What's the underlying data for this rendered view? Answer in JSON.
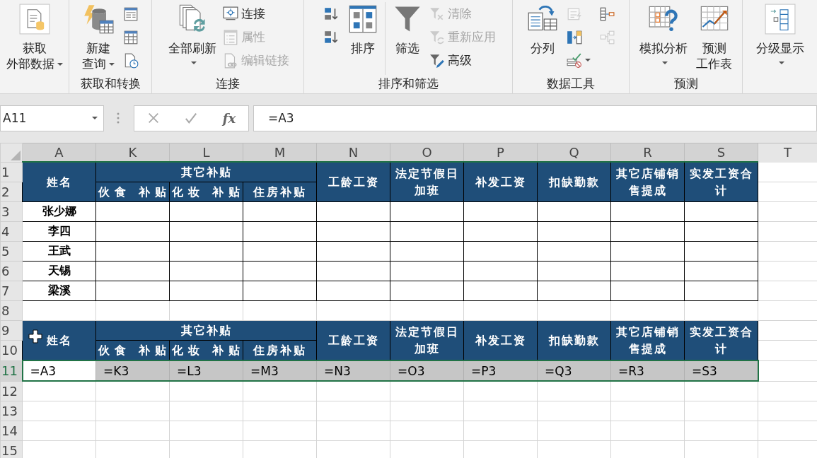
{
  "ribbon": {
    "groups": [
      {
        "columns": [
          [
            {
              "kind": "large",
              "lines": [
                "获取",
                "外部数据"
              ],
              "dropdown": true,
              "disabled": false
            }
          ]
        ]
      },
      {
        "label": "获取和转换",
        "columns": [
          [
            {
              "kind": "large",
              "lines": [
                "新建",
                "查询"
              ],
              "dropdown": true,
              "disabled": false
            }
          ],
          [
            {
              "kind": "icon",
              "disabled": false
            },
            {
              "kind": "icon",
              "disabled": false
            },
            {
              "kind": "icon",
              "disabled": false
            }
          ]
        ]
      },
      {
        "label": "连接",
        "columns": [
          [
            {
              "kind": "large",
              "lines": [
                "全部刷新"
              ],
              "dropdown": true,
              "disabled": false
            }
          ],
          [
            {
              "kind": "small",
              "label": "连接",
              "disabled": false
            },
            {
              "kind": "small",
              "label": "属性",
              "disabled": true
            },
            {
              "kind": "small",
              "label": "编辑链接",
              "disabled": true
            }
          ]
        ]
      },
      {
        "label": "排序和筛选",
        "columns": [
          [
            {
              "kind": "icon",
              "disabled": false
            },
            {
              "kind": "icon",
              "disabled": false
            }
          ],
          [
            {
              "kind": "large",
              "lines": [
                "排序"
              ],
              "disabled": false
            }
          ],
          [
            {
              "kind": "large",
              "lines": [
                "筛选"
              ],
              "disabled": false
            }
          ],
          [
            {
              "kind": "small",
              "label": "清除",
              "disabled": true
            },
            {
              "kind": "small",
              "label": "重新应用",
              "disabled": true
            },
            {
              "kind": "small",
              "label": "高级",
              "disabled": false
            }
          ]
        ]
      },
      {
        "label": "数据工具",
        "columns": [
          [
            {
              "kind": "large",
              "lines": [
                "分列"
              ],
              "disabled": false
            }
          ],
          [
            {
              "kind": "icon",
              "disabled": true
            },
            {
              "kind": "icon",
              "disabled": false
            },
            {
              "kind": "icon",
              "dropdown": true,
              "disabled": false
            }
          ],
          [
            {
              "kind": "icon",
              "disabled": false
            },
            {
              "kind": "icon",
              "disabled": true
            }
          ]
        ]
      },
      {
        "label": "预测",
        "columns": [
          [
            {
              "kind": "large",
              "lines": [
                "模拟分析"
              ],
              "dropdown": true,
              "disabled": false
            }
          ],
          [
            {
              "kind": "large",
              "lines": [
                "预测",
                "工作表"
              ],
              "disabled": false
            }
          ]
        ]
      },
      {
        "columns": [
          [
            {
              "kind": "large",
              "lines": [
                "分级显示"
              ],
              "dropdown": true,
              "disabled": false
            }
          ]
        ]
      }
    ]
  },
  "formula_bar": {
    "name_box": "A11",
    "function_label": "fx",
    "formula": "=A3"
  },
  "sheet": {
    "columns": [
      {
        "label": "A",
        "selected": true
      },
      {
        "label": "K",
        "selected": true
      },
      {
        "label": "L",
        "selected": true
      },
      {
        "label": "M",
        "selected": true
      },
      {
        "label": "N",
        "selected": true
      },
      {
        "label": "O",
        "selected": true
      },
      {
        "label": "P",
        "selected": true
      },
      {
        "label": "Q",
        "selected": true
      },
      {
        "label": "R",
        "selected": true
      },
      {
        "label": "S",
        "selected": true
      },
      {
        "label": "T",
        "selected": false
      }
    ],
    "rows": [
      {
        "number": "1",
        "selected": false,
        "kind": "header",
        "header": {
          "name": "姓名",
          "group": "其它补贴",
          "subs": [
            "伙食 补贴",
            "化妆 补贴",
            "住房补贴"
          ],
          "titles": [
            "工龄工资",
            "法定节假日加班",
            "补发工资",
            "扣缺勤款",
            "其它店铺销售提成",
            "实发工资合计"
          ]
        }
      },
      {
        "number": "2",
        "selected": false,
        "kind": "header_cont"
      },
      {
        "number": "3",
        "selected": false,
        "kind": "data",
        "name": "张少娜"
      },
      {
        "number": "4",
        "selected": false,
        "kind": "data",
        "name": "李四"
      },
      {
        "number": "5",
        "selected": false,
        "kind": "data",
        "name": "王武"
      },
      {
        "number": "6",
        "selected": false,
        "kind": "data",
        "name": "天锡"
      },
      {
        "number": "7",
        "selected": false,
        "kind": "data",
        "name": "梁溪"
      },
      {
        "number": "8",
        "selected": false,
        "kind": "blank"
      },
      {
        "number": "9",
        "selected": false,
        "kind": "header",
        "header": {
          "name": "姓名",
          "group": "其它补贴",
          "subs": [
            "伙食 补贴",
            "化妆 补贴",
            "住房补贴"
          ],
          "titles": [
            "工龄工资",
            "法定节假日加班",
            "补发工资",
            "扣缺勤款",
            "其它店铺销售提成",
            "实发工资合计"
          ]
        }
      },
      {
        "number": "10",
        "selected": false,
        "kind": "header_cont"
      },
      {
        "number": "11",
        "selected": true,
        "kind": "formula",
        "cells": [
          {
            "text": "=A3",
            "active": true
          },
          {
            "text": "=K3",
            "active": false
          },
          {
            "text": "=L3",
            "active": false
          },
          {
            "text": "=M3",
            "active": false
          },
          {
            "text": "=N3",
            "active": false
          },
          {
            "text": "=O3",
            "active": false
          },
          {
            "text": "=P3",
            "active": false
          },
          {
            "text": "=Q3",
            "active": false
          },
          {
            "text": "=R3",
            "active": false
          },
          {
            "text": "=S3",
            "active": false
          }
        ]
      },
      {
        "number": "12",
        "selected": false,
        "kind": "blank"
      },
      {
        "number": "13",
        "selected": false,
        "kind": "blank"
      },
      {
        "number": "14",
        "selected": false,
        "kind": "blank"
      },
      {
        "number": "15",
        "selected": false,
        "kind": "blank"
      }
    ]
  }
}
